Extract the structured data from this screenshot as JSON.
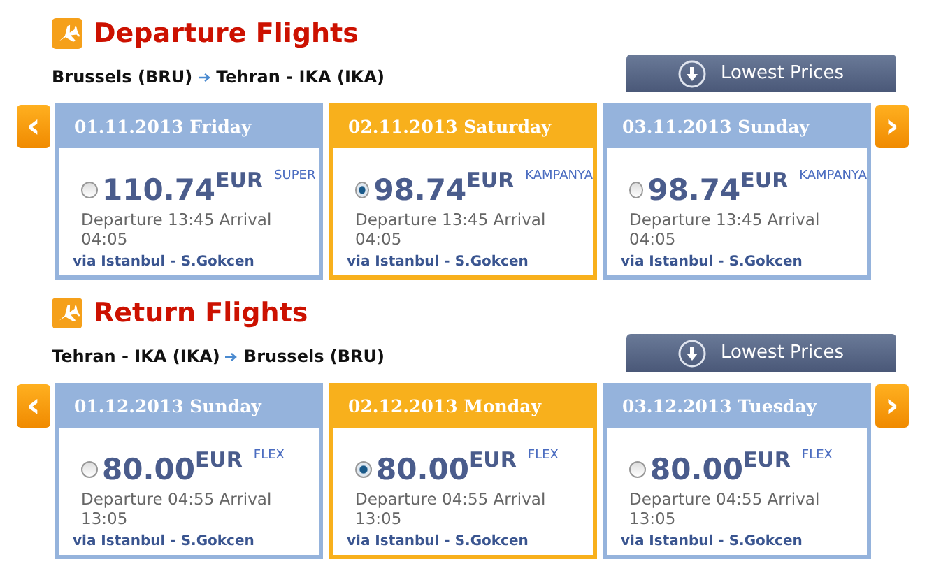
{
  "sections": [
    {
      "title": "Departure Flights",
      "origin": "Brussels (BRU)",
      "destination": "Tehran - IKA (IKA)",
      "button": "Lowest Prices",
      "prev": "‹",
      "next": "›",
      "days": [
        {
          "date": "01.11.2013 Friday",
          "selected": false,
          "price": "110.74",
          "currency": "EUR",
          "fare": "SUPER",
          "times": "Departure 13:45 Arrival 04:05",
          "via": "via Istanbul - S.Gokcen"
        },
        {
          "date": "02.11.2013 Saturday",
          "selected": true,
          "price": "98.74",
          "currency": "EUR",
          "fare": "KAMPANYA",
          "times": "Departure 13:45 Arrival 04:05",
          "via": "via Istanbul - S.Gokcen"
        },
        {
          "date": "03.11.2013 Sunday",
          "selected": false,
          "price": "98.74",
          "currency": "EUR",
          "fare": "KAMPANYA",
          "times": "Departure 13:45 Arrival 04:05",
          "via": "via Istanbul - S.Gokcen"
        }
      ]
    },
    {
      "title": "Return Flights",
      "origin": "Tehran - IKA (IKA)",
      "destination": "Brussels (BRU)",
      "button": "Lowest Prices",
      "prev": "‹",
      "next": "›",
      "days": [
        {
          "date": "01.12.2013 Sunday",
          "selected": false,
          "price": "80.00",
          "currency": "EUR",
          "fare": "FLEX",
          "times": "Departure 04:55 Arrival 13:05",
          "via": "via Istanbul - S.Gokcen"
        },
        {
          "date": "02.12.2013 Monday",
          "selected": true,
          "price": "80.00",
          "currency": "EUR",
          "fare": "FLEX",
          "times": "Departure 04:55 Arrival 13:05",
          "via": "via Istanbul - S.Gokcen"
        },
        {
          "date": "03.12.2013 Tuesday",
          "selected": false,
          "price": "80.00",
          "currency": "EUR",
          "fare": "FLEX",
          "times": "Departure 04:55 Arrival 13:05",
          "via": "via Istanbul - S.Gokcen"
        }
      ]
    }
  ]
}
